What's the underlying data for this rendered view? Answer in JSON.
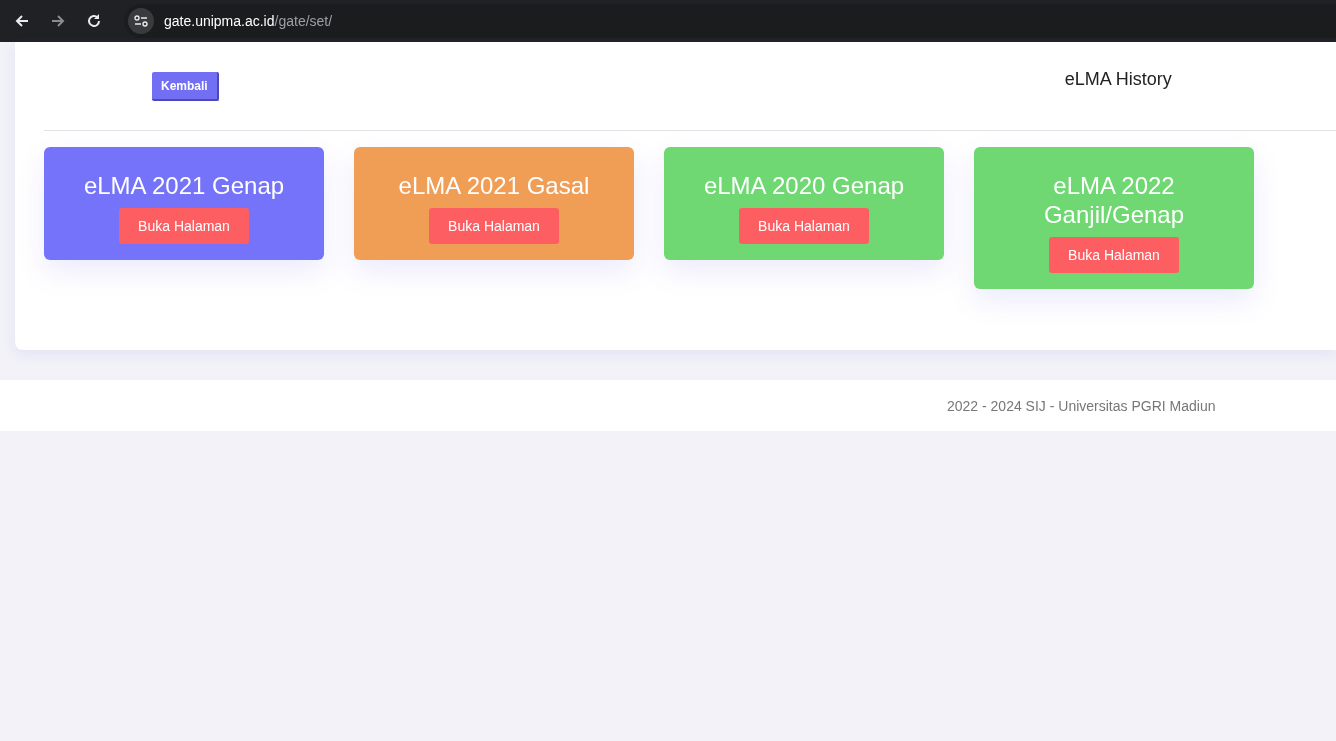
{
  "browser": {
    "url_host": "gate.unipma.ac.id",
    "url_path": "/gate/set/"
  },
  "header": {
    "back_button": "Kembali",
    "title": "eLMA History"
  },
  "cards": [
    {
      "title": "eLMA 2021 Genap",
      "button": "Buka Halaman",
      "color": "#7673fb"
    },
    {
      "title": "eLMA 2021 Gasal",
      "button": "Buka Halaman",
      "color": "#f09e56"
    },
    {
      "title": "eLMA 2020 Genap",
      "button": "Buka Halaman",
      "color": "#6fd872"
    },
    {
      "title": "eLMA 2022 Ganjil/Genap",
      "button": "Buka Halaman",
      "color": "#6fd872"
    }
  ],
  "footer": {
    "text": "2022 - 2024 SIJ - Universitas PGRI Madiun"
  }
}
